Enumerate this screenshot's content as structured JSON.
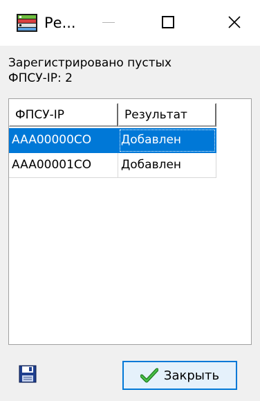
{
  "window": {
    "title": "Ре...",
    "icons": {
      "app": "server-icon",
      "minimize": "minimize-icon",
      "maximize": "maximize-icon",
      "close": "close-icon"
    }
  },
  "message": {
    "line1": "Зарегистрировано пустых",
    "line2": "ФПСУ-IP: 2"
  },
  "table": {
    "columns": [
      "ФПСУ-IP",
      "Результат"
    ],
    "rows": [
      {
        "id": "AAA00000CO",
        "result": "Добавлен",
        "selected": true
      },
      {
        "id": "AAA00001CO",
        "result": "Добавлен",
        "selected": false
      }
    ]
  },
  "footer": {
    "save_icon": "floppy-disk-icon",
    "close_label": "Закрыть",
    "close_icon": "checkmark-icon"
  },
  "colors": {
    "selection": "#0078d7",
    "checkmark": "#2e9e2e"
  }
}
